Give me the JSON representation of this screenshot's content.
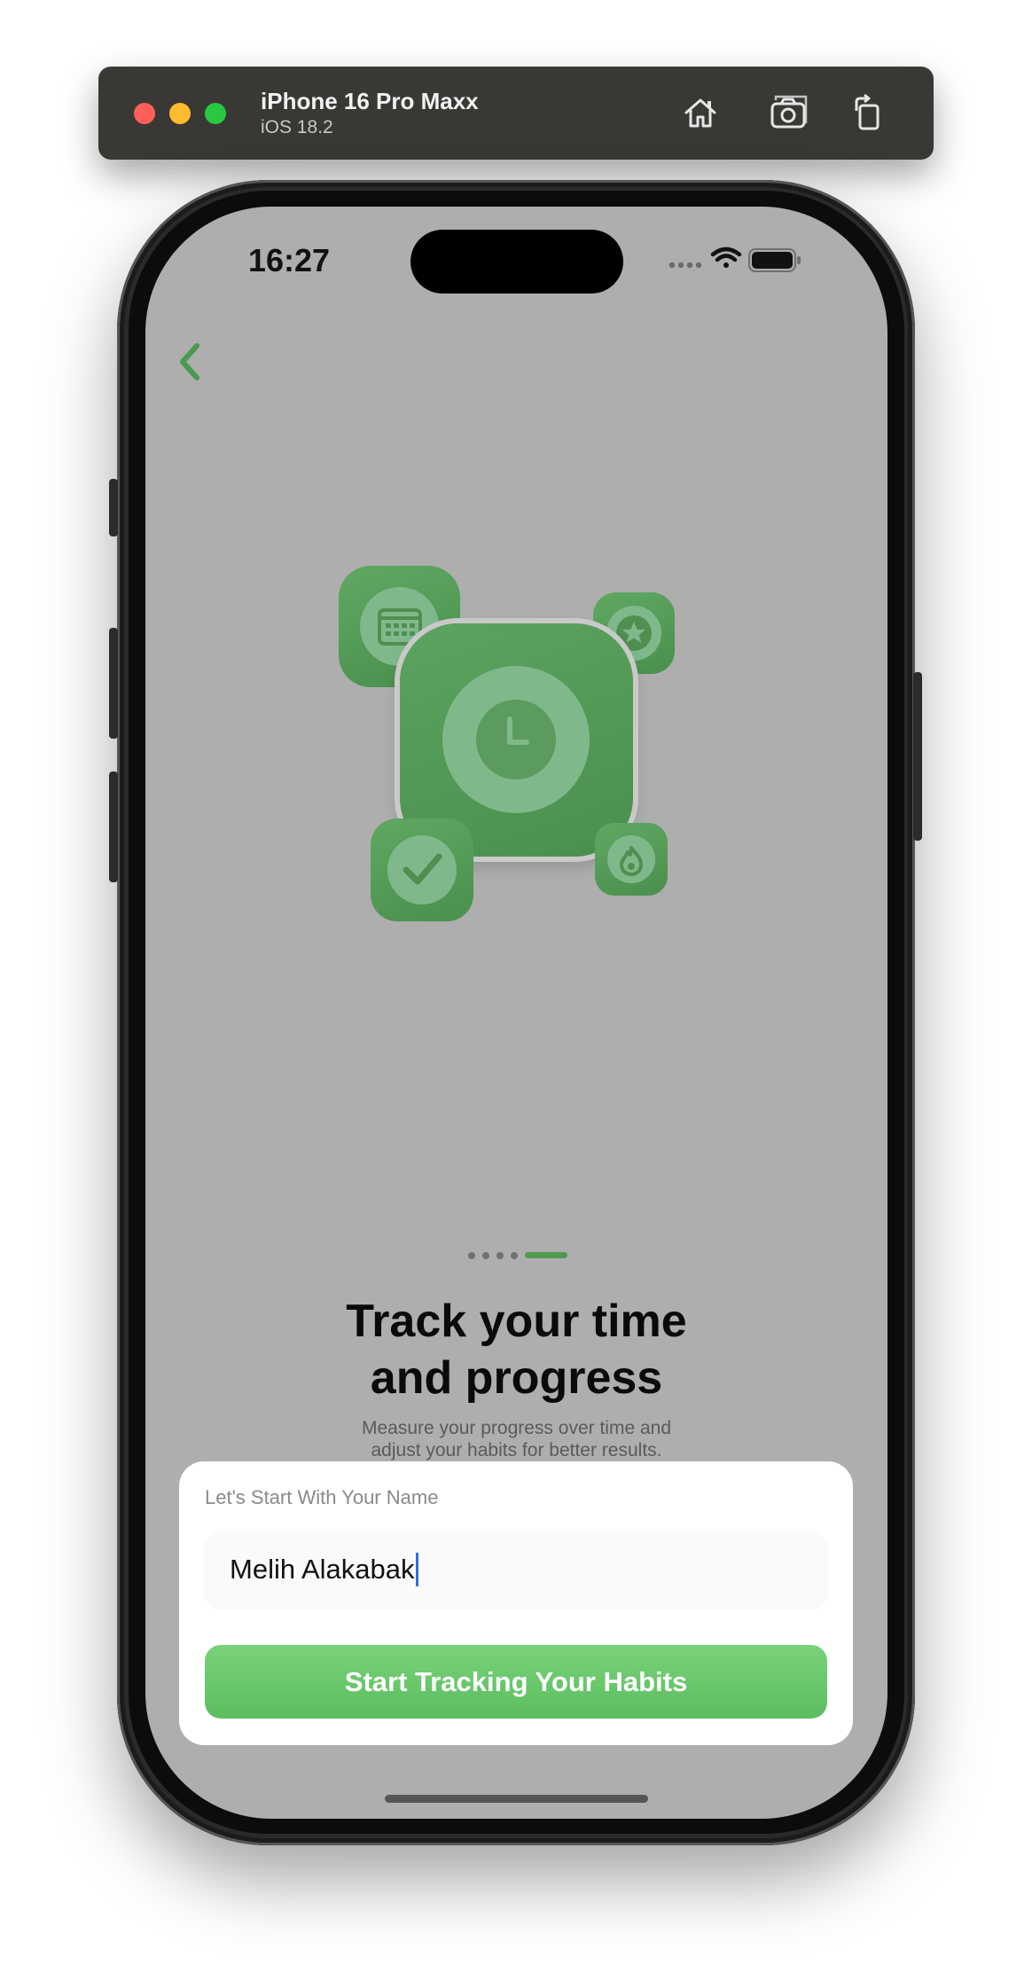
{
  "simulator": {
    "device_name": "iPhone 16 Pro Maxx",
    "os_version": "iOS 18.2",
    "icons": [
      "home-icon",
      "screenshot-icon",
      "rotate-icon"
    ]
  },
  "status_bar": {
    "time": "16:27",
    "icons": [
      "signal-icon",
      "wifi-icon",
      "battery-icon"
    ]
  },
  "nav": {
    "back_icon": "chevron-left-icon"
  },
  "illustration": {
    "icons": [
      "calendar-icon",
      "star-icon",
      "clock-icon",
      "checkmark-icon",
      "flame-icon"
    ],
    "accent_color": "#4e9a51"
  },
  "pager": {
    "page_count": 5,
    "current_page": 5
  },
  "onboarding": {
    "title": "Track your time\nand progress",
    "subtitle": "Measure your progress over time and\nadjust your habits for better results."
  },
  "name_sheet": {
    "label": "Let's Start With Your Name",
    "name_value": "Melih Alakabak",
    "cta_label": "Start Tracking Your Habits",
    "cta_color": "#6cc96e"
  }
}
